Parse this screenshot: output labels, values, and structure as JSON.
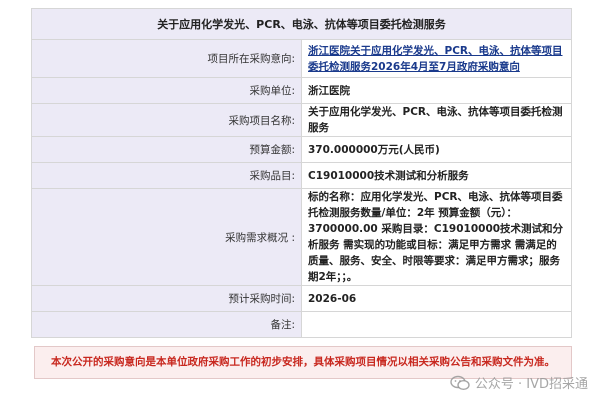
{
  "table": {
    "title": "关于应用化学发光、PCR、电泳、抗体等项目委托检测服务",
    "rows": [
      {
        "label": "项目所在采购意向:",
        "value": "浙江医院关于应用化学发光、PCR、电泳、抗体等项目委托检测服务2026年4月至7月政府采购意向"
      },
      {
        "label": "采购单位:",
        "value": "浙江医院"
      },
      {
        "label": "采购项目名称:",
        "value": "关于应用化学发光、PCR、电泳、抗体等项目委托检测服务"
      },
      {
        "label": "预算金额:",
        "value": "370.000000万元(人民币)"
      },
      {
        "label": "采购品目:",
        "value": "C19010000技术测试和分析服务"
      },
      {
        "label": "采购需求概况 :",
        "value": "标的名称：应用化学发光、PCR、电泳、抗体等项目委托检测服务数量/单位：2年 预算金额（元）：3700000.00 采购目录：C19010000技术测试和分析服务 需实现的功能或目标：满足甲方需求 需满足的质量、服务、安全、时限等要求：满足甲方需求；服务期2年；；。"
      },
      {
        "label": "预计采购时间:",
        "value": "2026-06"
      },
      {
        "label": "备注:",
        "value": ""
      }
    ]
  },
  "notice": "本次公开的采购意向是本单位政府采购工作的初步安排，具体采购项目情况以相关采购公告和采购文件为准。",
  "watermark": "公众号 · IVD招采通",
  "colors": {
    "label_bg": "#eceaf6",
    "link": "#1a3a8c",
    "notice_text": "#c8281f",
    "notice_bg": "#fbeeee"
  }
}
